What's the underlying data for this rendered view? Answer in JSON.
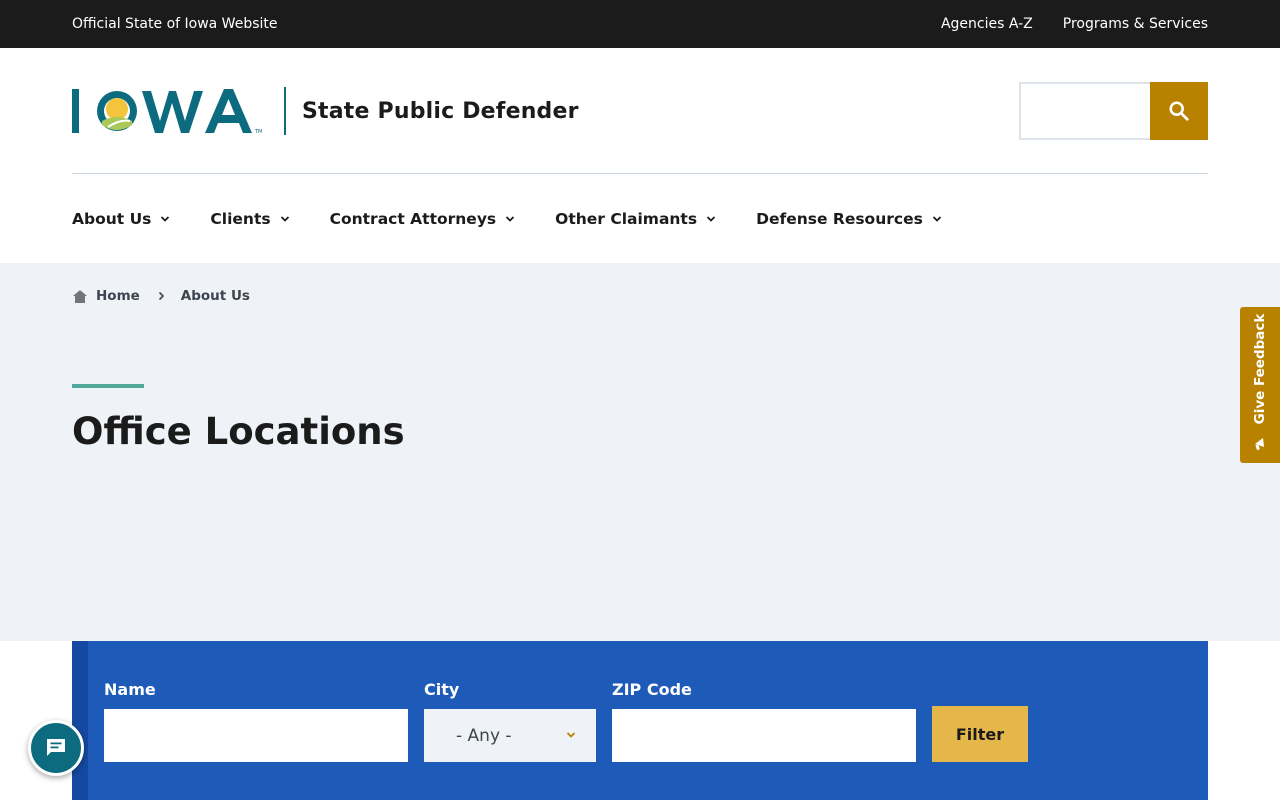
{
  "topbar": {
    "official_text": "Official State of Iowa Website",
    "links": [
      "Agencies A-Z",
      "Programs & Services"
    ]
  },
  "header": {
    "logo_text": "IOWA",
    "site_name": "State Public Defender",
    "search_placeholder": ""
  },
  "nav": {
    "items": [
      {
        "label": "About Us"
      },
      {
        "label": "Clients"
      },
      {
        "label": "Contract Attorneys"
      },
      {
        "label": "Other Claimants"
      },
      {
        "label": "Defense Resources"
      }
    ]
  },
  "breadcrumb": {
    "items": [
      "Home",
      "About Us"
    ]
  },
  "page": {
    "title": "Office Locations"
  },
  "filter": {
    "name_label": "Name",
    "city_label": "City",
    "city_value": "- Any -",
    "zip_label": "ZIP Code",
    "submit_label": "Filter"
  },
  "feedback": {
    "label": "Give Feedback"
  },
  "colors": {
    "topbar": "#1b1b1b",
    "brand_teal": "#0d6b80",
    "gold": "#b88200",
    "filter_blue": "#1e5bb8",
    "filter_button": "#e5b64a",
    "hero_bg": "#eff2f6"
  },
  "icons": {
    "search": "search-icon",
    "home": "home-icon",
    "chat": "chat-icon",
    "feedback": "megaphone-icon"
  }
}
